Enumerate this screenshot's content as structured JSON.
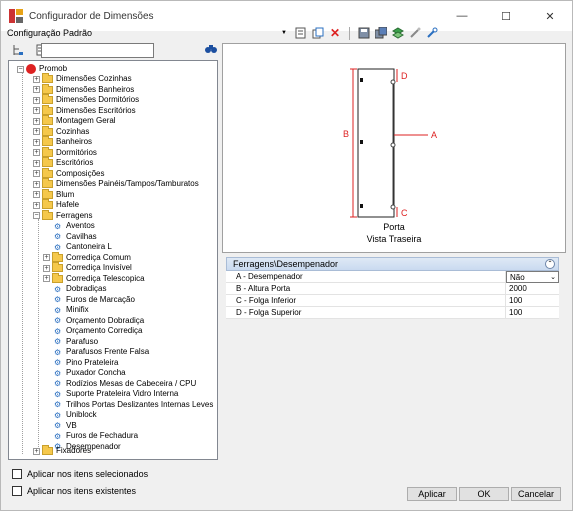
{
  "window": {
    "title": "Configurador de Dimensões",
    "controls": {
      "minimize": "—",
      "maximize": "☐",
      "close": "✕"
    }
  },
  "header": {
    "config_label": "Configuração Padrão"
  },
  "search": {
    "value": "",
    "placeholder": ""
  },
  "tree": {
    "root": "Promob",
    "items": [
      "Dimensões Cozinhas",
      "Dimensões Banheiros",
      "Dimensões Dormitórios",
      "Dimensões Escritórios",
      "Montagem Geral",
      "Cozinhas",
      "Banheiros",
      "Dormitórios",
      "Escritórios",
      "Composições",
      "Dimensões Painéis/Tampos/Tamburatos",
      "Blum",
      "Hafele",
      "Ferragens"
    ],
    "ferragens_children": [
      "Aventos",
      "Cavilhas",
      "Cantoneira L",
      "Corrediça Comum",
      "Corrediça Invisível",
      "Corrediça Telescopica",
      "Dobradiças",
      "Furos de Marcação",
      "Minifix",
      "Orçamento Dobradiça",
      "Orçamento Corrediça",
      "Parafuso",
      "Parafusos Frente Falsa",
      "Pino Prateleira",
      "Puxador Concha",
      "Rodízios Mesas de Cabeceira / CPU",
      "Suporte Prateleira Vidro Interna",
      "Trilhos Portas Deslizantes Internas Leves",
      "Uniblock",
      "VB",
      "Furos de Fechadura",
      "Desempenador"
    ],
    "last_item": "Fixadores"
  },
  "preview": {
    "labels": {
      "a": "A",
      "b": "B",
      "c": "C",
      "d": "D"
    },
    "caption_line1": "Porta",
    "caption_line2": "Vista Traseira"
  },
  "properties": {
    "header": "Ferragens\\Desempenador",
    "rows": [
      {
        "name": "A - Desempenador",
        "value": "Não"
      },
      {
        "name": "B - Altura Porta",
        "value": "2000"
      },
      {
        "name": "C - Folga Inferior",
        "value": "100"
      },
      {
        "name": "D - Folga Superior",
        "value": "100"
      }
    ]
  },
  "options": {
    "apply_selected": "Aplicar nos itens selecionados",
    "apply_existing": "Aplicar nos itens existentes"
  },
  "buttons": {
    "apply": "Aplicar",
    "ok": "OK",
    "cancel": "Cancelar"
  },
  "colors": {
    "accent_red": "#d22222",
    "folder": "#f5c84c",
    "header_blue": "#c9daf0"
  }
}
